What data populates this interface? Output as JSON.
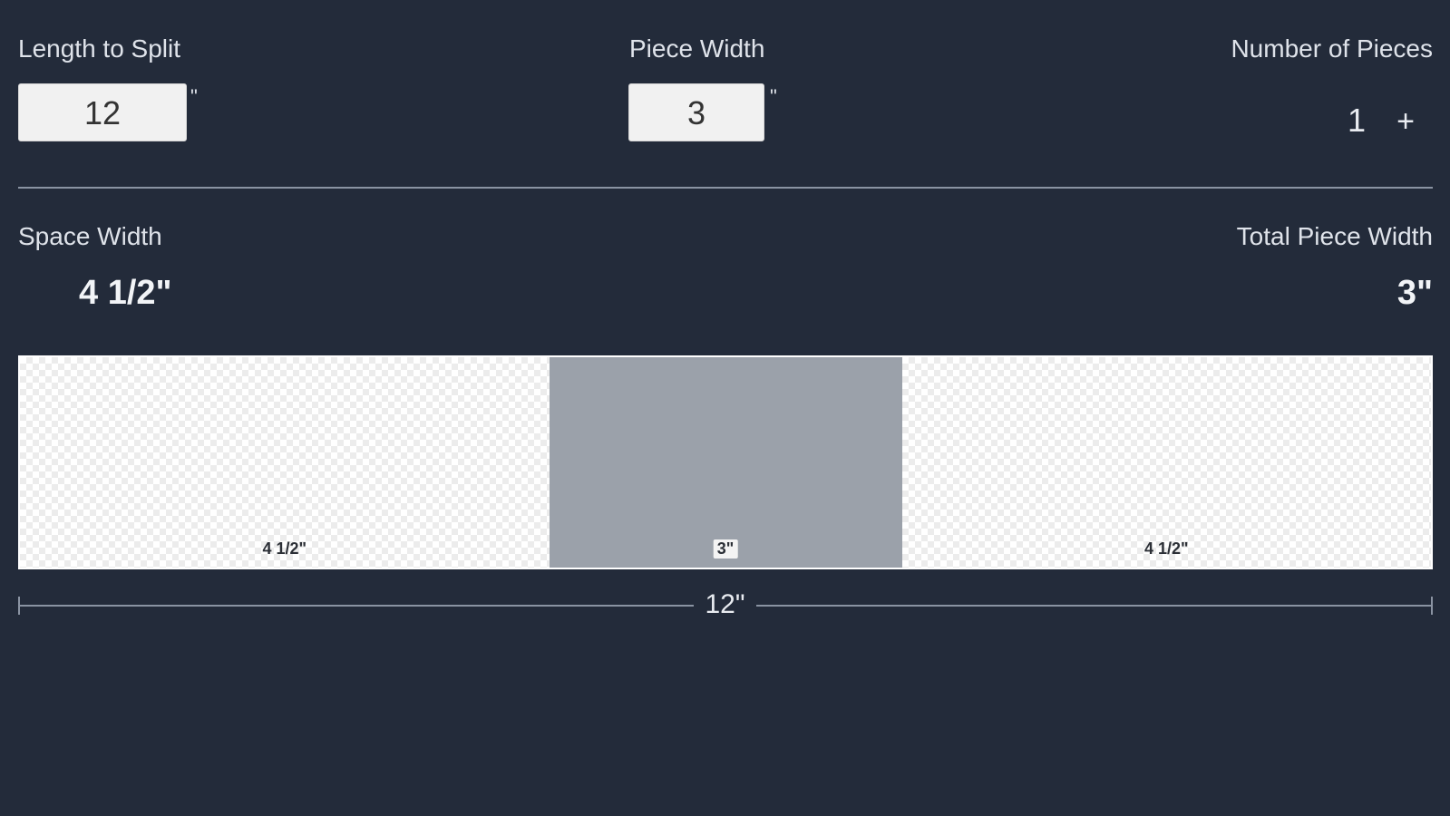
{
  "inputs": {
    "length_label": "Length to Split",
    "length_value": "12",
    "length_unit": "\"",
    "piece_width_label": "Piece Width",
    "piece_width_value": "3",
    "piece_width_unit": "\"",
    "pieces_label": "Number of Pieces",
    "pieces_value": "1",
    "plus_label": "+"
  },
  "results": {
    "space_width_label": "Space Width",
    "space_width_value": "4 1/2\"",
    "total_piece_width_label": "Total Piece Width",
    "total_piece_width_value": "3\""
  },
  "diagram": {
    "segments": [
      {
        "type": "space",
        "label": "4 1/2\"",
        "inches": 4.5
      },
      {
        "type": "piece",
        "label": "3\"",
        "inches": 3
      },
      {
        "type": "space",
        "label": "4 1/2\"",
        "inches": 4.5
      }
    ],
    "total_label": "12\"",
    "total_inches": 12
  },
  "colors": {
    "background": "#232b3a",
    "piece_fill": "#9ba1aa",
    "space_fill": "#ffffff"
  }
}
